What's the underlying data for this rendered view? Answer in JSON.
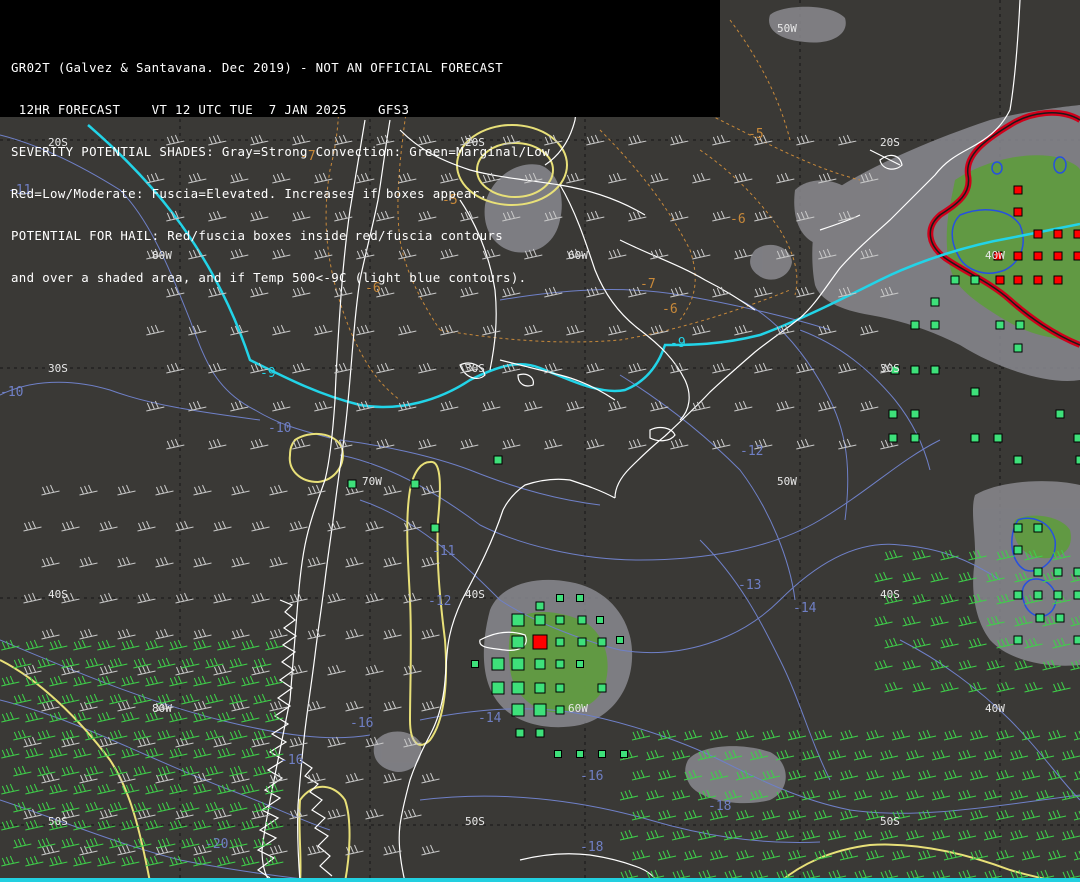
{
  "header": {
    "lines": [
      "GR02T (Galvez & Santavana. Dec 2019) - NOT AN OFFICIAL FORECAST",
      " 12HR FORECAST    VT 12 UTC TUE  7 JAN 2025    GFS3",
      "SEVERITY POTENTIAL SHADES: Gray=Strong Convection: Green=Marginal/Low",
      "Red=Low/Moderate: Fuscia=Elevated. Increases if boxes appear.",
      "POTENTIAL FOR HAIL: Red/fuscia boxes inside red/fuscia contours",
      "and over a shaded area, and if Temp 500<-9C (light blue contours)."
    ]
  },
  "grid_labels": {
    "lat_20s_a": "20S",
    "lat_20s_b": "20S",
    "lat_20s_c": "20S",
    "lon_50w_top": "50W",
    "lon_80w_a": "80W",
    "lon_60w_a": "60W",
    "lon_40w_a": "40W",
    "lat_30s_a": "30S",
    "lat_30s_b": "30S",
    "lat_30s_c": "30S",
    "lon_70w": "70W",
    "lon_50w_mid": "50W",
    "lat_40s_a": "40S",
    "lat_40s_b": "40S",
    "lat_40s_c": "40S",
    "lon_80w_b": "80W",
    "lon_60w_b": "60W",
    "lon_40w_b": "40W",
    "lat_50s_a": "50S",
    "lat_50s_b": "50S",
    "lat_50s_c": "50S"
  },
  "contour_labels": {
    "blue": [
      "-11",
      "-10",
      "-10",
      "-11",
      "-12",
      "-12",
      "-13",
      "-14",
      "-16",
      "-14",
      "-16",
      "-16",
      "-18",
      "-18",
      "-20"
    ],
    "orange": [
      "-7",
      "-5",
      "-6",
      "-6",
      "-7",
      "-6",
      "-5"
    ],
    "cyan": [
      "-9",
      "-9"
    ]
  },
  "colors": {
    "background": "#3a3936",
    "coastline": "#ffffff",
    "severity_gray": "#8a8a8f",
    "severity_green": "#5e9c3c",
    "hail_box_green": "#3ee07a",
    "hail_box_red": "#ff0000",
    "contour_yellow": "#e8e078",
    "contour_blue_temp": "#6f80c8",
    "contour_cyan": "#22d4e8",
    "contour_orange": "#c8893a",
    "wind_barbs_gray": "#c8c8c8",
    "wind_barbs_green": "#3fd04a",
    "severity_red_contour": "#d0001a"
  }
}
